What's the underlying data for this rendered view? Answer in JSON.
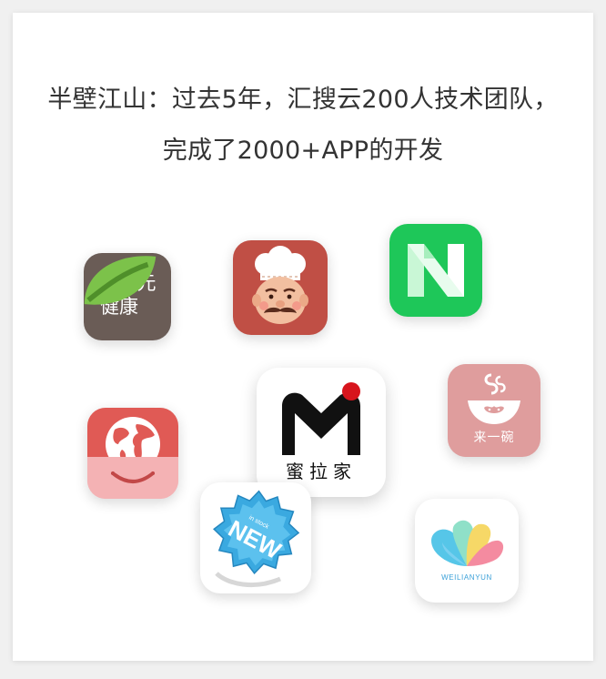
{
  "headline": {
    "line1": "半壁江山：过去5年，汇搜云200人技术团队，",
    "line2": "完成了2000+APP的开发"
  },
  "apps": [
    {
      "id": "guchen",
      "line1": "谷辰元",
      "line2": "健康",
      "icon": "guchen-health-app-icon",
      "color": "#6a5c56"
    },
    {
      "id": "chef",
      "icon": "chef-app-icon",
      "color": "#c04f45"
    },
    {
      "id": "n",
      "letter": "N",
      "icon": "n-letter-app-icon",
      "color": "#1ec759"
    },
    {
      "id": "globe",
      "icon": "globe-shopping-bag-app-icon",
      "color": "#f3b4b6"
    },
    {
      "id": "mila",
      "letter": "M",
      "label": "蜜拉家",
      "icon": "mila-home-app-icon",
      "color": "#ffffff"
    },
    {
      "id": "bowl",
      "label": "来一碗",
      "icon": "noodle-bowl-app-icon",
      "color": "#df9d9d"
    },
    {
      "id": "new",
      "sticker_text": "NEW",
      "sticker_small": "in stock",
      "icon": "new-sticker-app-icon",
      "color": "#3aa9e0"
    },
    {
      "id": "wly",
      "label": "WEILIANYUN",
      "icon": "flower-petal-app-icon",
      "color": "#ffffff"
    }
  ]
}
